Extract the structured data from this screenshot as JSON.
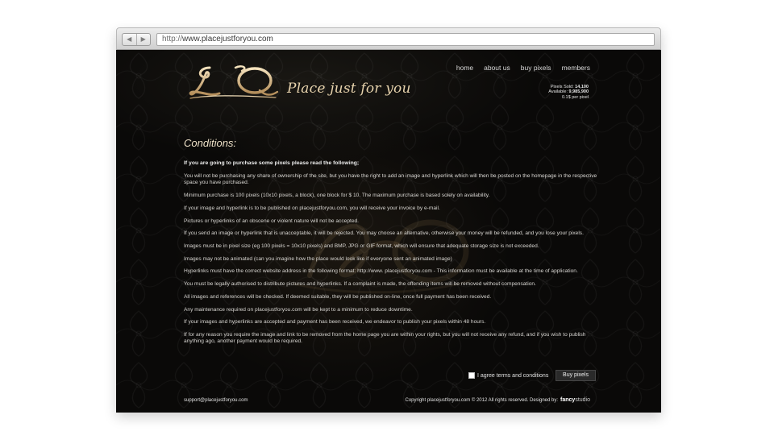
{
  "browser": {
    "back_glyph": "◀",
    "forward_glyph": "▶",
    "url_scheme": "http://",
    "url_host": "www.placejustforyou.com"
  },
  "site": {
    "logo_monogram_letters": "L Q",
    "name": "Place just for you",
    "nav": [
      {
        "label": "home"
      },
      {
        "label": "about us"
      },
      {
        "label": "buy pixels"
      },
      {
        "label": "members"
      }
    ],
    "stats": [
      {
        "label": "Pixels Sold:",
        "value": "14,100"
      },
      {
        "label": "Available:",
        "value": "9,985,900"
      },
      {
        "label": "",
        "value": "0.1$ per pixel"
      }
    ]
  },
  "main": {
    "heading": "Conditions:",
    "intro": "If you are going to purchase some pixels please read the following;",
    "conditions": [
      "You will not be purchasing any share of ownership of the site, but you have the right to add an image and hyperlink which will then be posted on the homepage in the respective space you have purchased.",
      "Minimum purchase is 100 pixels (10x10 pixels, a block), one block for $ 10. The maximum purchase is based solely on availability.",
      "If your image and hyperlink is to be published on placejustforyou.com, you will receive your invoice by e-mail.",
      "Pictures or hyperlinks of an obscene or violent nature will not be accepted.",
      "If you send an image or hyperlink that is unacceptable, it will be rejected. You may choose an alternative, otherwise your money will be refunded, and you lose your pixels.",
      "Images must be in pixel size (eg 100 pixels = 10x10 pixels) and BMP, JPG or GIF format, which will ensure that adequate storage size is not exceeded.",
      "Images may not be animated (can you imagine how the place would look like if everyone sent an animated image)",
      "Hyperlinks must have the correct website address in the following format: http://www. placejustforyou.com - This information must be available at the time of application.",
      "You must be legally authorised to distribute pictures and hyperlinks. If a complaint is made, the offending items will be removed without compensation.",
      "All images and references will be checked. If deemed suitable, they will be published on-line, once full payment has been received.",
      "Any maintenance required on placejustforyou.com will be kept to a minimum to reduce downtime.",
      "If your images and hyperlinks are accepted and payment has been received, we endeavor to publish your pixels within 48 hours.",
      "If for any reason you require the image and link to be removed from the home page you are within your rights, but you will not receive any refund, and if you wish to publish anything ago, another payment would be required."
    ],
    "agree_label": "I agree terms and conditions",
    "agree_checked": false,
    "buy_button": "Buy pixels"
  },
  "footer": {
    "email": "support@placejustforyou.com",
    "copyright": "Copyright placejustforyou.com © 2012 All rights reserved. Designed by:",
    "designer_bold": "fancy",
    "designer_light": "studio"
  },
  "colors": {
    "page_bg": "#0a0908",
    "gold": "#d9bf8c",
    "text": "#d8d6d2"
  },
  "icons": [
    "back-arrow-icon",
    "forward-arrow-icon",
    "checkbox-icon"
  ]
}
